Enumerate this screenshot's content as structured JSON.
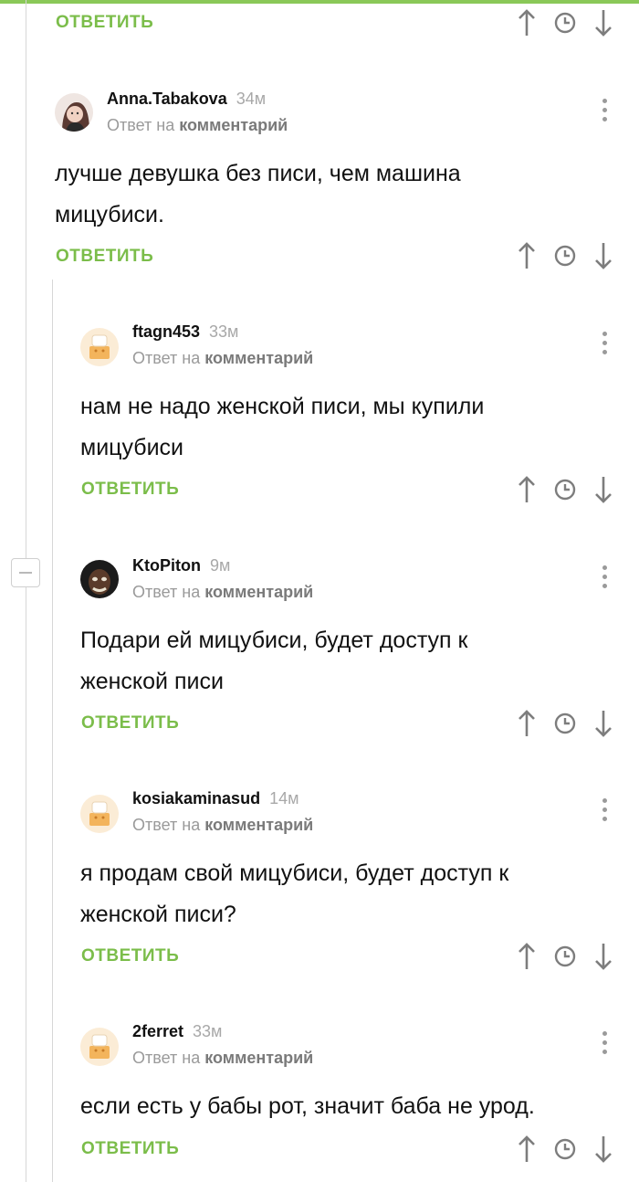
{
  "colors": {
    "accent": "#7bbd4a",
    "topbar": "#8ac858",
    "meta": "#9a9a9a"
  },
  "icons": {
    "up": "arrow-up-icon",
    "time": "clock-icon",
    "down": "arrow-down-icon",
    "more": "more-vertical-icon"
  },
  "reply_label": "ОТВЕТИТЬ",
  "reply_prefix": "Ответ на",
  "reply_target": "комментарий",
  "comments": [
    {
      "username": "Anna.Tabakova",
      "age": "34м",
      "lines": [
        "лучше девушка без писи, чем машина",
        "мицубиси."
      ]
    },
    {
      "username": "ftagn453",
      "age": "33м",
      "lines": [
        "нам не надо женской писи, мы купили",
        "мицубиси"
      ]
    },
    {
      "username": "KtoPiton",
      "age": "9м",
      "lines": [
        "Подари ей мицубиси, будет доступ к",
        "женской писи"
      ]
    },
    {
      "username": "kosiakaminasud",
      "age": "14м",
      "lines": [
        "я продам свой мицубиси, будет доступ к",
        "женской писи?"
      ]
    },
    {
      "username": "2ferret",
      "age": "33м",
      "lines": [
        "если есть у бабы рот, значит баба не урод."
      ]
    }
  ]
}
